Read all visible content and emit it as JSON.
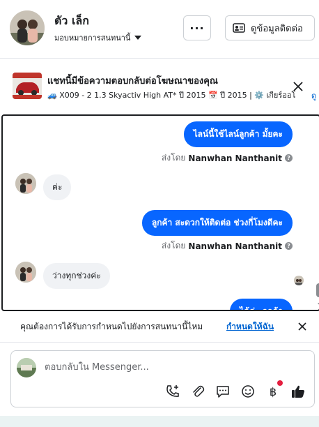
{
  "header": {
    "name": "ตัว เล็ก",
    "assign_label": "มอบหมายการสนทนานี้",
    "more_label": "···",
    "contact_label": "ดูข้อมูลติดต่อ"
  },
  "ad_banner": {
    "title": "แชทนี้มีข้อความตอบกลับต่อโฆษณาของคุณ",
    "detail": "🚙 X009 - 2 1.3 Skyactiv High AT* ปี 2015 📅 ปี 2015 | ⚙️ เกียร์ออโ",
    "link_text": "ดู"
  },
  "messages": [
    {
      "direction": "out",
      "text": "ไลน์นี้ใช้ไลน์ลูกค้า มั้ยคะ"
    },
    {
      "type": "sent_by",
      "prefix": "ส่งโดย",
      "sender": "Nanwhan Nanthanit"
    },
    {
      "direction": "in",
      "text": "ค่ะ"
    },
    {
      "direction": "out",
      "text": "ลูกค้า สะดวกให้ติดต่อ ช่วงกี่โมงดีคะ"
    },
    {
      "type": "sent_by",
      "prefix": "ส่งโดย",
      "sender": "Nanwhan Nanthanit"
    },
    {
      "direction": "in",
      "text": "ว่างทุกช่วงค่ะ"
    },
    {
      "direction": "out",
      "text": "ได้ค่ะ ลูกค้า"
    }
  ],
  "reminder": {
    "text": "คุณต้องการได้รับการกำหนดไปยังการสนทนานี้ไหม",
    "link": "กำหนดให้ฉัน"
  },
  "composer": {
    "placeholder": "ตอบกลับใน Messenger..."
  },
  "icons": {
    "tools": [
      "call-add-icon",
      "attachment-icon",
      "saved-reply-icon",
      "emoji-icon",
      "payment-baht-icon",
      "like-icon"
    ]
  },
  "colors": {
    "accent": "#0866ff",
    "link": "#0064d1",
    "incoming_bubble": "#f0f2f5",
    "notification_dot": "#e41e3f"
  }
}
